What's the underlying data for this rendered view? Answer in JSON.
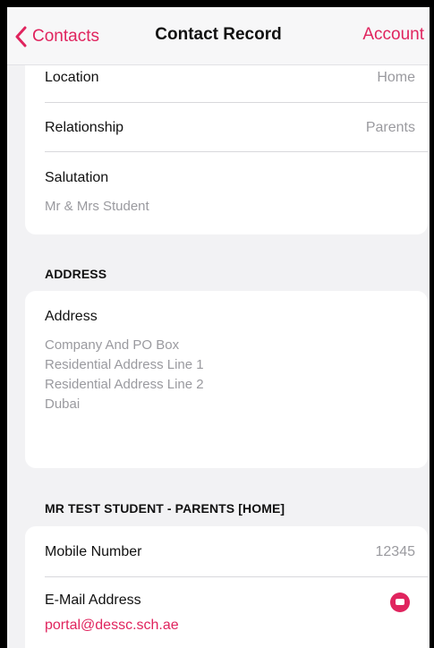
{
  "nav": {
    "back_label": "Contacts",
    "title": "Contact Record",
    "right_label": "Account",
    "accent": "#e0245e"
  },
  "details": {
    "location_label": "Location",
    "location_value": "Home",
    "relationship_label": "Relationship",
    "relationship_value": "Parents",
    "salutation_label": "Salutation",
    "salutation_value": "Mr & Mrs Student"
  },
  "address_section": {
    "header": "ADDRESS",
    "label": "Address",
    "lines": [
      "Company And PO Box",
      "Residential Address Line 1",
      "Residential Address Line 2",
      "Dubai"
    ]
  },
  "contact_section": {
    "header": "MR TEST STUDENT - PARENTS [HOME]",
    "mobile_label": "Mobile Number",
    "mobile_value": "12345",
    "email_label": "E-Mail Address",
    "email_value": "portal@dessc.sch.ae",
    "email_icon": "mail-icon"
  }
}
